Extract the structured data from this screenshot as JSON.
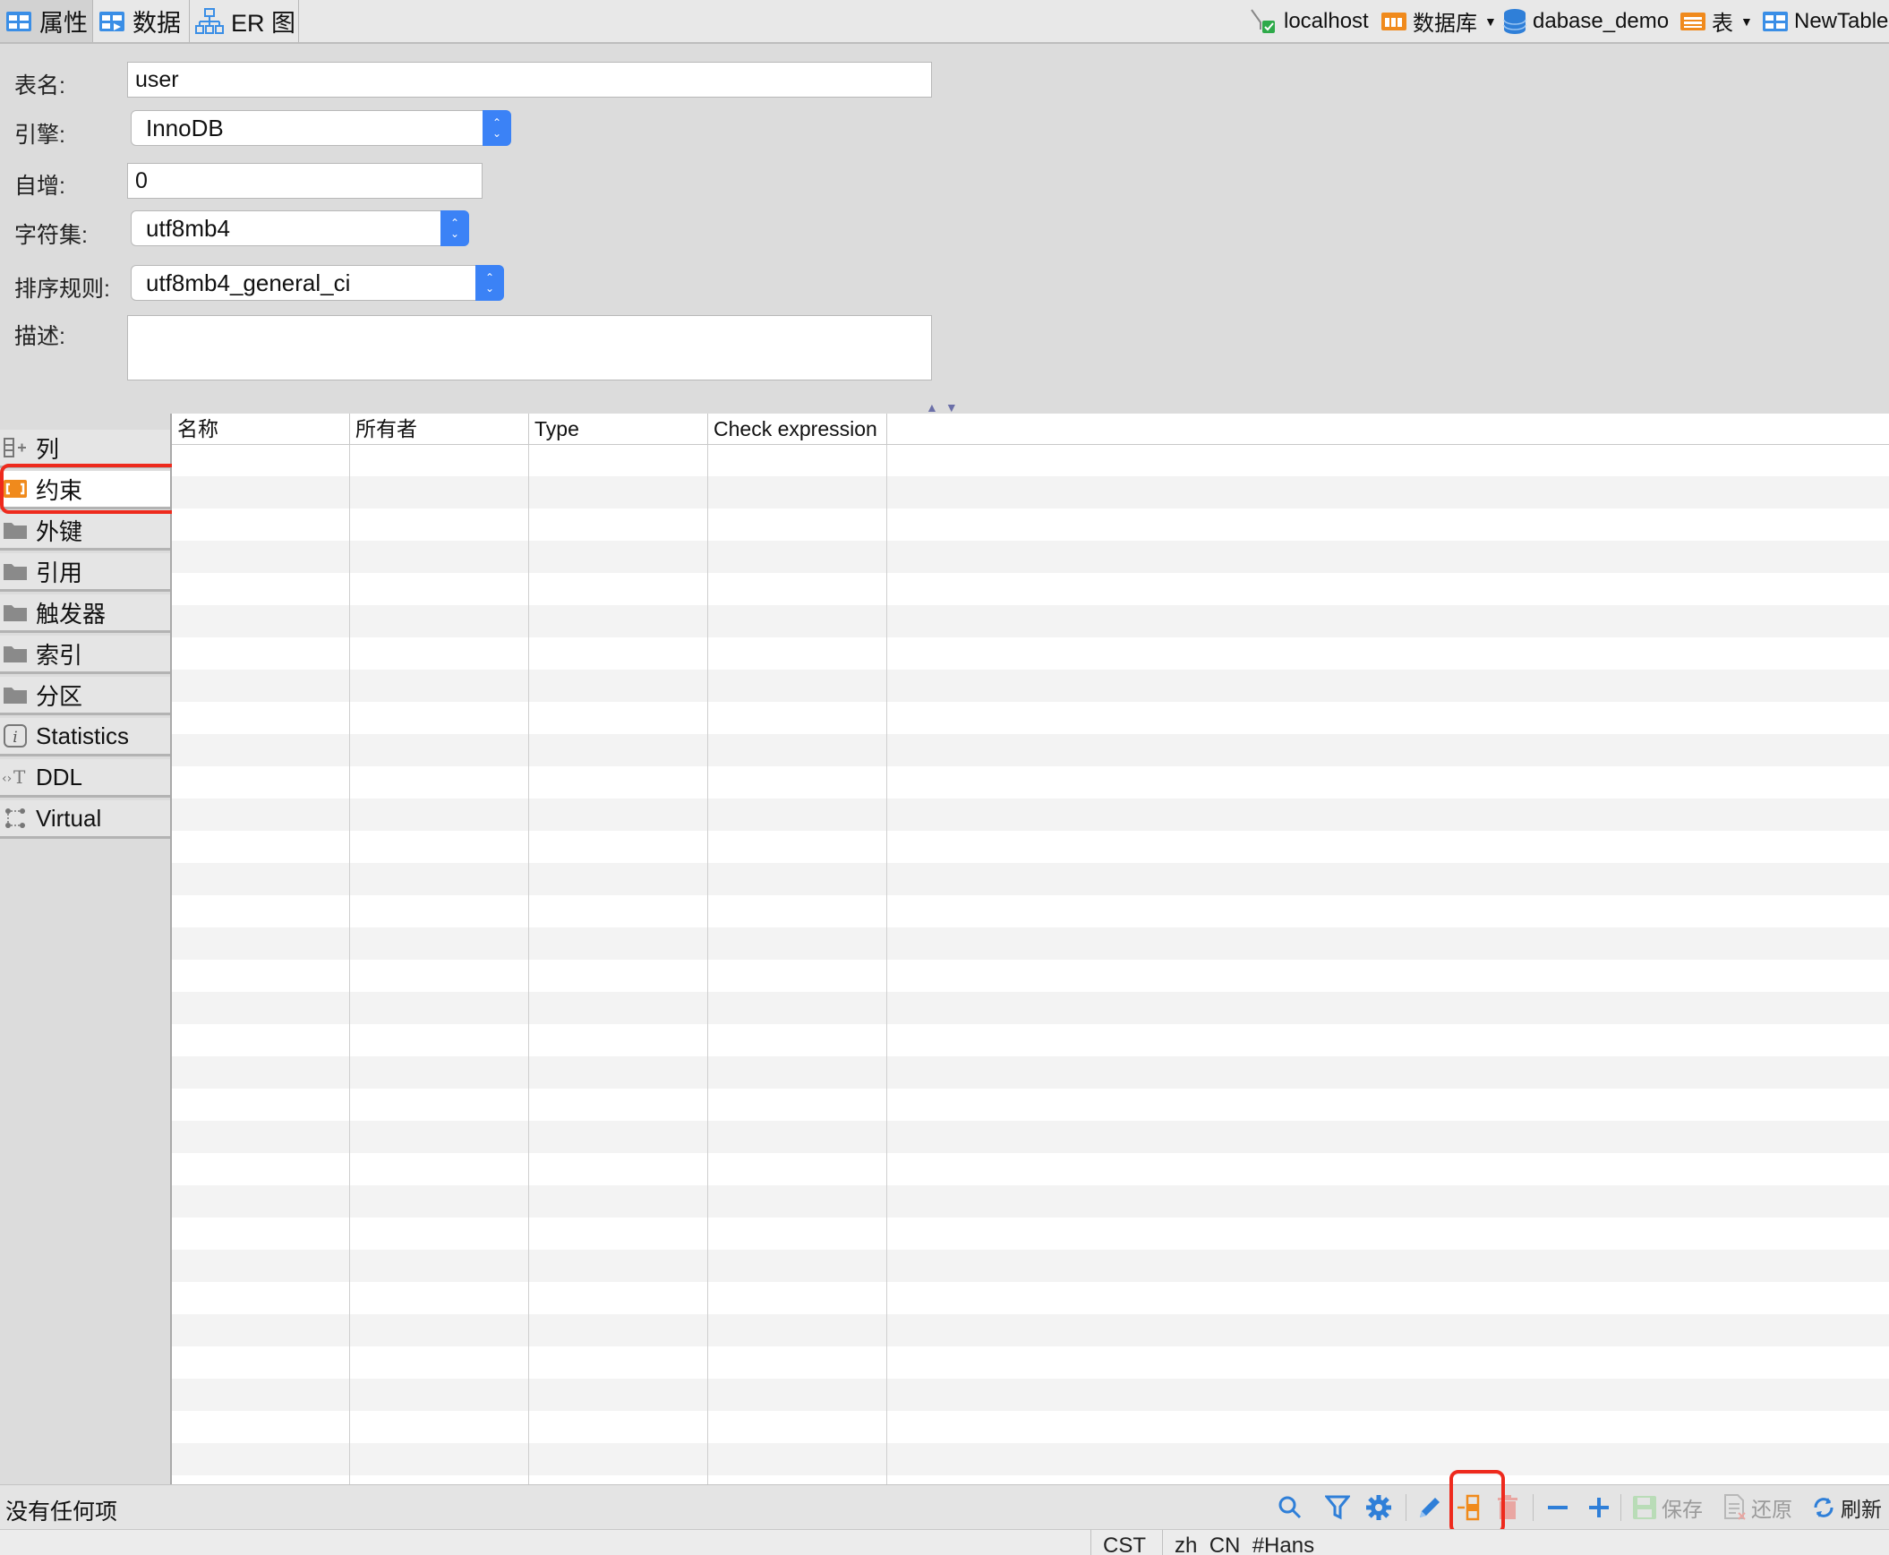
{
  "tabs": [
    {
      "label": "属性",
      "icon": "table-grid-icon",
      "active": true
    },
    {
      "label": "数据",
      "icon": "table-data-icon",
      "active": false
    },
    {
      "label": "ER 图",
      "icon": "er-diagram-icon",
      "active": false
    }
  ],
  "breadcrumb": {
    "host": "localhost",
    "database_folder": "数据库",
    "database": "dabase_demo",
    "tables_folder": "表",
    "table": "NewTable"
  },
  "form": {
    "table_name_label": "表名:",
    "table_name_value": "user",
    "engine_label": "引擎:",
    "engine_value": "InnoDB",
    "auto_increment_label": "自增:",
    "auto_increment_value": "0",
    "charset_label": "字符集:",
    "charset_value": "utf8mb4",
    "collation_label": "排序规则:",
    "collation_value": "utf8mb4_general_ci",
    "description_label": "描述:",
    "description_value": ""
  },
  "sidebar": {
    "items": [
      {
        "label": "列",
        "icon": "column-add-icon"
      },
      {
        "label": "约束",
        "icon": "constraint-folder-icon",
        "active": true
      },
      {
        "label": "外键",
        "icon": "folder-icon"
      },
      {
        "label": "引用",
        "icon": "folder-icon"
      },
      {
        "label": "触发器",
        "icon": "folder-icon"
      },
      {
        "label": "索引",
        "icon": "folder-icon"
      },
      {
        "label": "分区",
        "icon": "folder-icon"
      },
      {
        "label": "Statistics",
        "icon": "info-icon"
      },
      {
        "label": "DDL",
        "icon": "ddl-text-icon"
      },
      {
        "label": "Virtual",
        "icon": "virtual-nodes-icon"
      }
    ]
  },
  "table": {
    "columns": [
      "名称",
      "所有者",
      "Type",
      "Check expression"
    ],
    "rows": []
  },
  "toolbar": {
    "status": "没有任何项",
    "save_label": "保存",
    "revert_label": "还原",
    "refresh_label": "刷新"
  },
  "statusbar": {
    "timezone": "CST",
    "locale": "zh_CN_#Hans"
  },
  "colors": {
    "accent_blue": "#3b82f6",
    "highlight_red": "#ee2a1d",
    "folder_orange": "#f08a1c"
  }
}
